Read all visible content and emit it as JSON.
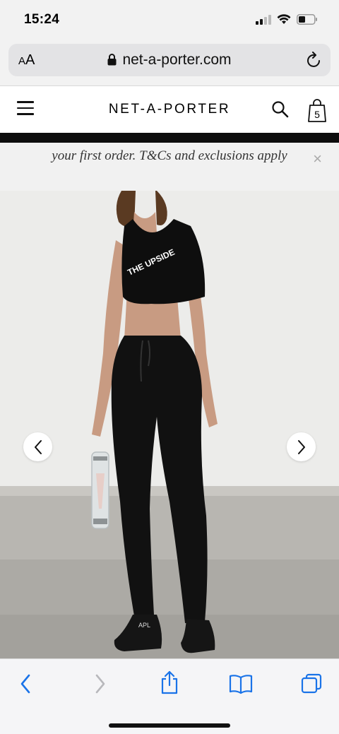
{
  "status_bar": {
    "time": "15:24",
    "icons": [
      "cellular-signal-icon",
      "wifi-icon",
      "battery-icon"
    ]
  },
  "browser": {
    "text_size_label_small": "A",
    "text_size_label_large": "A",
    "url": "net-a-porter.com",
    "icons": [
      "lock-icon",
      "reload-icon"
    ]
  },
  "site_header": {
    "brand": "NET-A-PORTER",
    "bag_count": "5",
    "icons": [
      "hamburger-menu-icon",
      "search-icon",
      "shopping-bag-icon"
    ]
  },
  "promo_banner": {
    "text": "your first order. T&Cs and exclusions apply",
    "close_label": "×"
  },
  "product_image": {
    "top_logo": "THE UPSIDE",
    "shoe_logo": "APL",
    "icons": [
      "chevron-left-icon",
      "chevron-right-icon"
    ]
  },
  "toolbar": {
    "icons": [
      "back-icon",
      "forward-icon",
      "share-icon",
      "bookmarks-icon",
      "tabs-icon"
    ]
  },
  "colors": {
    "chrome_bg": "#f2f2f2",
    "ios_blue": "#1a73e8",
    "brand_black": "#0d0d0d"
  }
}
